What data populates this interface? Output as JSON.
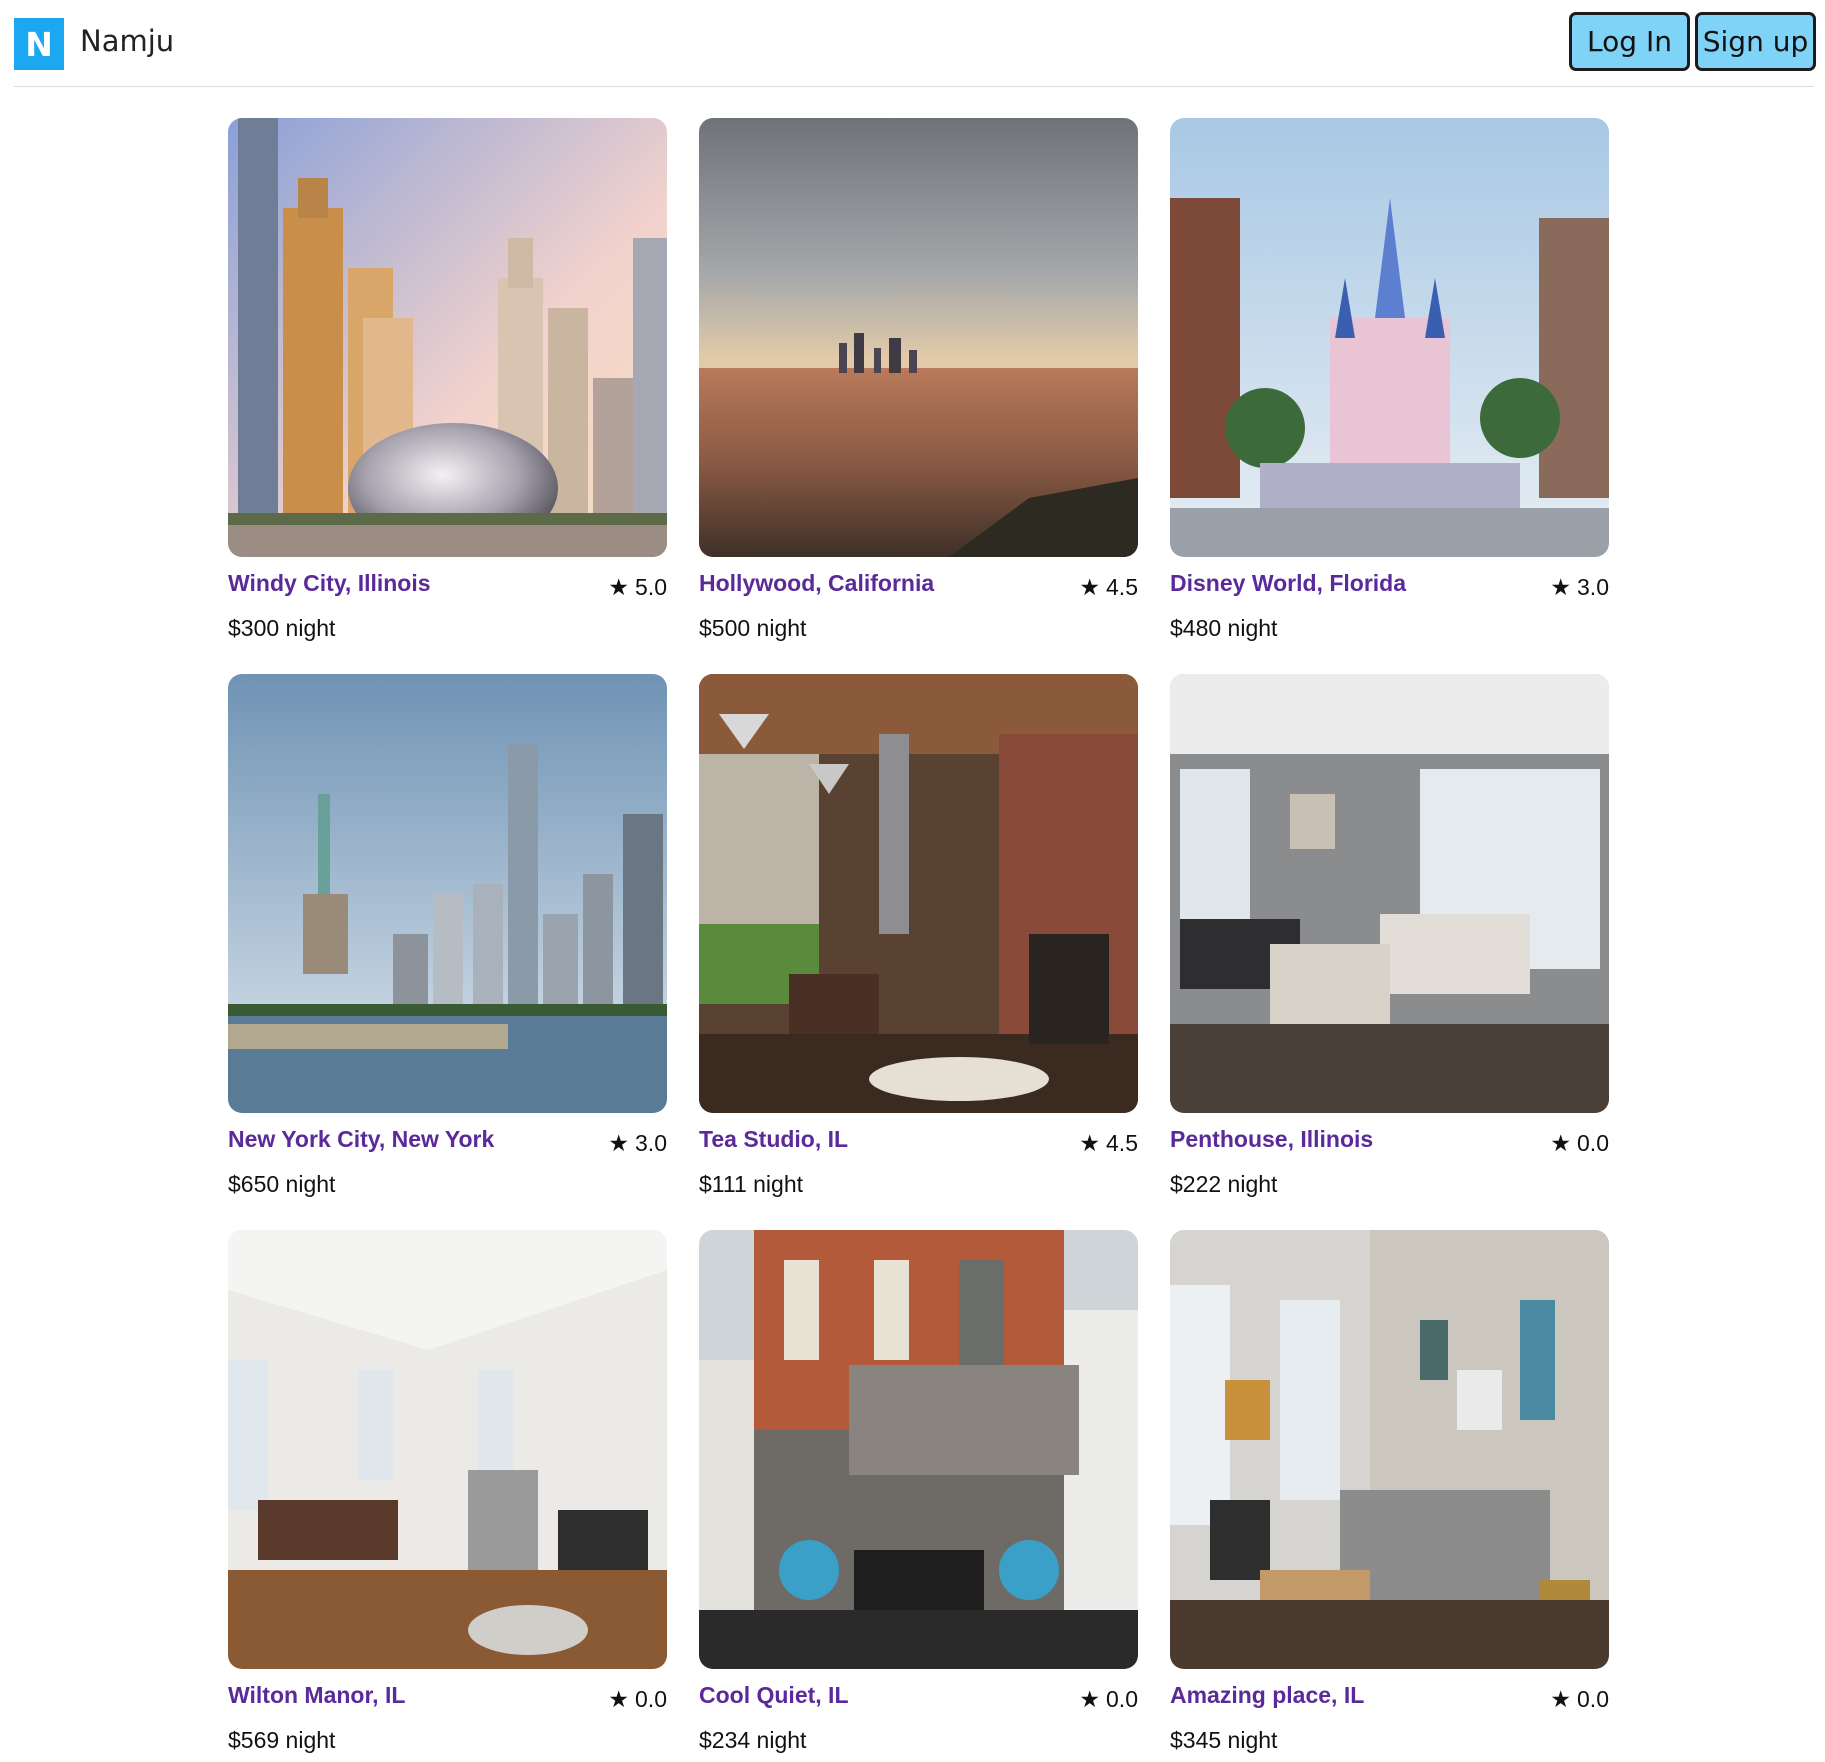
{
  "header": {
    "logo_letter": "N",
    "brand": "Namju",
    "login_label": "Log In",
    "signup_label": "Sign up"
  },
  "colors": {
    "logo_bg": "#1ba8f0",
    "button_bg": "#7fd3f7",
    "title_color": "#5a2a9a"
  },
  "icons": {
    "rating": "star-icon"
  },
  "listings": [
    {
      "title": "Windy City, Illinois",
      "rating": "5.0",
      "price": "$300 night",
      "photo": "Chicago skyline with Cloud Gate sculpture"
    },
    {
      "title": "Hollywood, California",
      "rating": "4.5",
      "price": "$500 night",
      "photo": "Los Angeles skyline at sunset"
    },
    {
      "title": "Disney World, Florida",
      "rating": "3.0",
      "price": "$480 night",
      "photo": "Cinderella castle with characters"
    },
    {
      "title": "New York City, New York",
      "rating": "3.0",
      "price": "$650 night",
      "photo": "Statue of Liberty and Manhattan skyline"
    },
    {
      "title": "Tea Studio, IL",
      "rating": "4.5",
      "price": "$111 night",
      "photo": "Industrial loft interior with pendant lights"
    },
    {
      "title": "Penthouse, Illinois",
      "rating": "0.0",
      "price": "$222 night",
      "photo": "Modern living room with white sofas"
    },
    {
      "title": "Wilton Manor, IL",
      "rating": "0.0",
      "price": "$569 night",
      "photo": "Bright dining room and kitchen"
    },
    {
      "title": "Cool Quiet, IL",
      "rating": "0.0",
      "price": "$234 night",
      "photo": "Brick house backyard patio"
    },
    {
      "title": "Amazing place, IL",
      "rating": "0.0",
      "price": "$345 night",
      "photo": "Living room with reclaimed wood wall"
    }
  ]
}
